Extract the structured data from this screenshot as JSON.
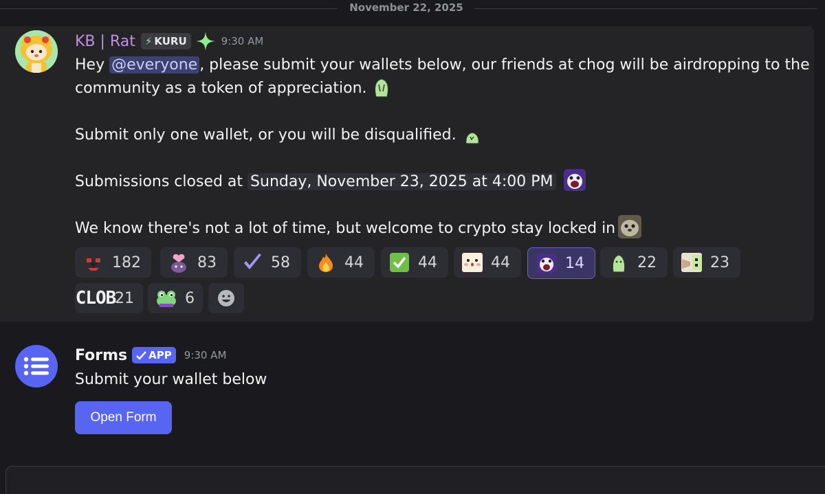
{
  "divider": {
    "date": "November 22, 2025"
  },
  "message1": {
    "username": "KB | Rat",
    "tag": "KURU",
    "time": "9:30 AM",
    "line1_pre": "Hey ",
    "mention": "@everyone",
    "line1_post": ", please submit your wallets below, our friends at chog will be airdropping to the",
    "line2": "community as a token of appreciation.",
    "line3": "Submit only one wallet, or you will be disqualified.",
    "line4_pre": "Submissions closed at ",
    "timestamp": "Sunday, November 23, 2025 at 4:00 PM",
    "line5": "We know there's not a lot of time, but welcome to crypto stay locked in",
    "reactions": [
      {
        "icon": "heart-hands-emoji",
        "count": "182"
      },
      {
        "icon": "heart-character-emoji",
        "count": "83"
      },
      {
        "icon": "purple-check-emoji",
        "count": "58"
      },
      {
        "icon": "fire-emoji",
        "count": "44"
      },
      {
        "icon": "green-check-emoji",
        "count": "44"
      },
      {
        "icon": "blush-face-emoji",
        "count": "44"
      },
      {
        "icon": "scream-cat-emoji",
        "count": "14"
      },
      {
        "icon": "green-blob-emoji",
        "count": "22"
      },
      {
        "icon": "pointing-emoji",
        "count": "23"
      },
      {
        "icon": "clob-text-emoji",
        "label": "CLOB",
        "count": "21"
      },
      {
        "icon": "frog-emoji",
        "count": "6"
      }
    ]
  },
  "message2": {
    "username": "Forms",
    "badge": "APP",
    "time": "9:30 AM",
    "text": "Submit your wallet below",
    "button": "Open Form"
  },
  "colors": {
    "accent": "#5865f2",
    "username1": "#c08fe0",
    "mention_bg": "#3c4270"
  }
}
